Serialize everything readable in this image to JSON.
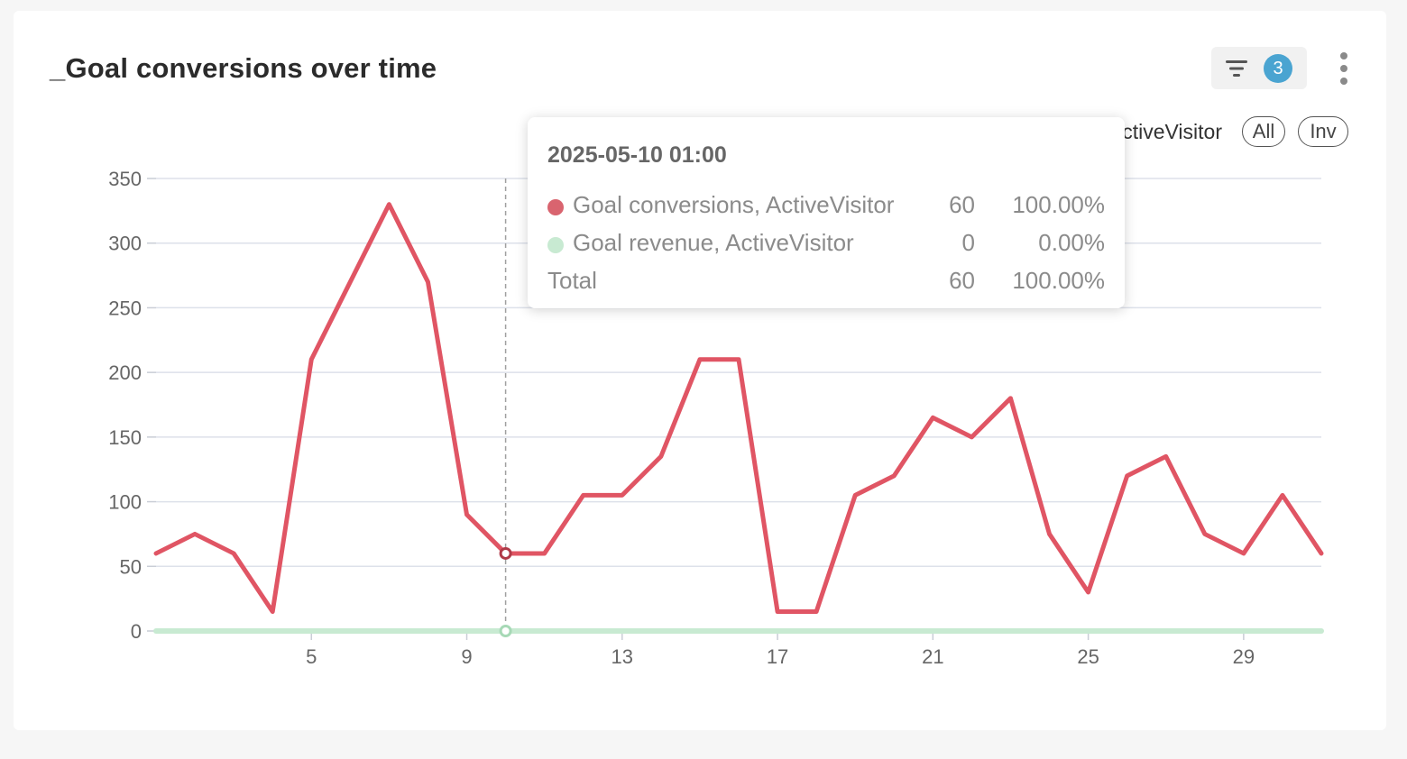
{
  "header": {
    "title": "_Goal conversions over time",
    "filter_count": "3",
    "filter_icon": "filter-icon",
    "more_icon": "more-vertical-icon"
  },
  "legend": {
    "all_label": "All",
    "inv_label": "Inv",
    "series_2_visible_text": "ActiveVisitor"
  },
  "tooltip": {
    "date": "2025-05-10 01:00",
    "rows": [
      {
        "label": "Goal conversions, ActiveVisitor",
        "value": "60",
        "percent": "100.00%",
        "color": "#d9646f"
      },
      {
        "label": "Goal revenue, ActiveVisitor",
        "value": "0",
        "percent": "0.00%",
        "color": "#c8ead2"
      }
    ],
    "total": {
      "label": "Total",
      "value": "60",
      "percent": "100.00%"
    }
  },
  "chart_data": {
    "type": "line",
    "x": [
      1,
      2,
      3,
      4,
      5,
      6,
      7,
      8,
      9,
      10,
      11,
      12,
      13,
      14,
      15,
      16,
      17,
      18,
      19,
      20,
      21,
      22,
      23,
      24,
      25,
      26,
      27,
      28,
      29,
      30,
      31
    ],
    "x_tick_labels": [
      "5",
      "9",
      "13",
      "17",
      "21",
      "25",
      "29"
    ],
    "x_tick_values": [
      5,
      9,
      13,
      17,
      21,
      25,
      29
    ],
    "y_tick_labels": [
      "0",
      "50",
      "100",
      "150",
      "200",
      "250",
      "300",
      "350"
    ],
    "ylim": [
      0,
      350
    ],
    "grid": true,
    "legend_position": "top-right",
    "highlight_x": 10,
    "series": [
      {
        "name": "Goal conversions, ActiveVisitor",
        "color": "#e05564",
        "values": [
          60,
          75,
          60,
          15,
          210,
          270,
          330,
          270,
          90,
          60,
          60,
          105,
          105,
          135,
          210,
          210,
          15,
          15,
          105,
          120,
          165,
          150,
          180,
          75,
          30,
          120,
          135,
          75,
          60,
          105,
          60
        ]
      },
      {
        "name": "Goal revenue, ActiveVisitor",
        "color": "#c8ead2",
        "values": [
          0,
          0,
          0,
          0,
          0,
          0,
          0,
          0,
          0,
          0,
          0,
          0,
          0,
          0,
          0,
          0,
          0,
          0,
          0,
          0,
          0,
          0,
          0,
          0,
          0,
          0,
          0,
          0,
          0,
          0,
          0
        ]
      }
    ]
  }
}
